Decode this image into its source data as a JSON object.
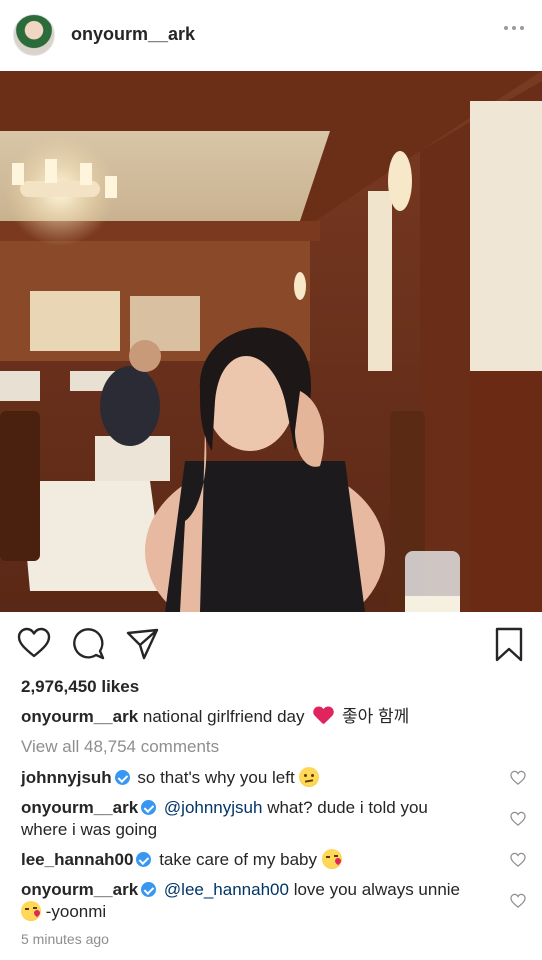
{
  "header": {
    "username": "onyourm__ark"
  },
  "post": {
    "likes": "2,976,450 likes",
    "caption": {
      "author": "onyourm__ark",
      "text_before": "national girlfriend day",
      "emoji": "red-heart",
      "text_after": "좋아 함께"
    },
    "view_all": "View all 48,754 comments",
    "time": "5 minutes ago"
  },
  "comments": [
    {
      "author": "johnnyjsuh",
      "verified": true,
      "mention": "",
      "text": "so that's why you left",
      "emoji": "thinking-face"
    },
    {
      "author": "onyourm__ark",
      "verified": true,
      "mention": "@johnnyjsuh",
      "text": "what? dude i told you",
      "text2": "where i was going"
    },
    {
      "author": "lee_hannah00",
      "verified": true,
      "mention": "",
      "text": "take care of my baby",
      "emoji": "kissing-face"
    },
    {
      "author": "onyourm__ark",
      "verified": true,
      "mention": "@lee_hannah00",
      "text": "love you always unnie",
      "emoji": "kissing-face",
      "text2": "-yoonmi"
    }
  ],
  "icons": {
    "like": "heart-icon",
    "comment": "comment-icon",
    "share": "paper-plane-icon",
    "save": "bookmark-icon",
    "more": "more-dots-icon"
  },
  "colors": {
    "text": "#262626",
    "secondary": "#8e8e8e",
    "mention": "#003569",
    "verified": "#3897f0",
    "heart": "#e0245e"
  }
}
